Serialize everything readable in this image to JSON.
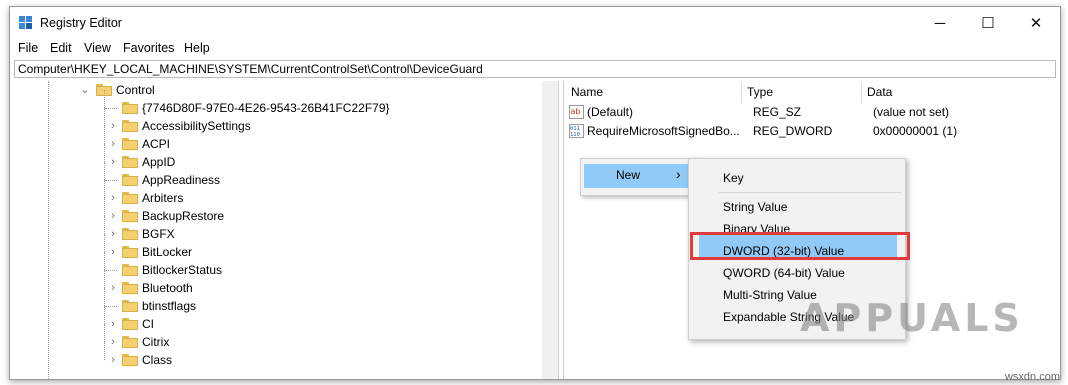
{
  "window": {
    "title": "Registry Editor"
  },
  "window_controls": {
    "minimize": "─",
    "maximize": "☐",
    "close": "✕"
  },
  "menu": [
    "File",
    "Edit",
    "View",
    "Favorites",
    "Help"
  ],
  "address": "Computer\\HKEY_LOCAL_MACHINE\\SYSTEM\\CurrentControlSet\\Control\\DeviceGuard",
  "tree": {
    "parent": "Control",
    "children": [
      {
        "label": "{7746D80F-97E0-4E26-9543-26B41FC22F79}",
        "expandable": false
      },
      {
        "label": "AccessibilitySettings",
        "expandable": true
      },
      {
        "label": "ACPI",
        "expandable": true
      },
      {
        "label": "AppID",
        "expandable": true
      },
      {
        "label": "AppReadiness",
        "expandable": false
      },
      {
        "label": "Arbiters",
        "expandable": true
      },
      {
        "label": "BackupRestore",
        "expandable": true
      },
      {
        "label": "BGFX",
        "expandable": true
      },
      {
        "label": "BitLocker",
        "expandable": true
      },
      {
        "label": "BitlockerStatus",
        "expandable": false
      },
      {
        "label": "Bluetooth",
        "expandable": true
      },
      {
        "label": "btinstflags",
        "expandable": false
      },
      {
        "label": "CI",
        "expandable": true
      },
      {
        "label": "Citrix",
        "expandable": true
      },
      {
        "label": "Class",
        "expandable": true
      }
    ]
  },
  "values_pane": {
    "columns": [
      "Name",
      "Type",
      "Data"
    ],
    "rows": [
      {
        "name": "(Default)",
        "type": "REG_SZ",
        "data": "(value not set)",
        "icon": "string-value-icon"
      },
      {
        "name": "RequireMicrosoftSignedBo...",
        "type": "REG_DWORD",
        "data": "0x00000001 (1)",
        "icon": "binary-value-icon"
      }
    ]
  },
  "context_menu": {
    "new_label": "New",
    "arrow": "›",
    "submenu": [
      "Key",
      "String Value",
      "Binary Value",
      "DWORD (32-bit) Value",
      "QWORD (64-bit) Value",
      "Multi-String Value",
      "Expandable String Value"
    ],
    "highlighted": "DWORD (32-bit) Value"
  },
  "watermark": {
    "text": "APPUALS",
    "site": "wsxdn.com"
  },
  "colors": {
    "highlight": "#91c9f7",
    "annotation": "#e23b3b",
    "folder": "#f4d06f"
  }
}
